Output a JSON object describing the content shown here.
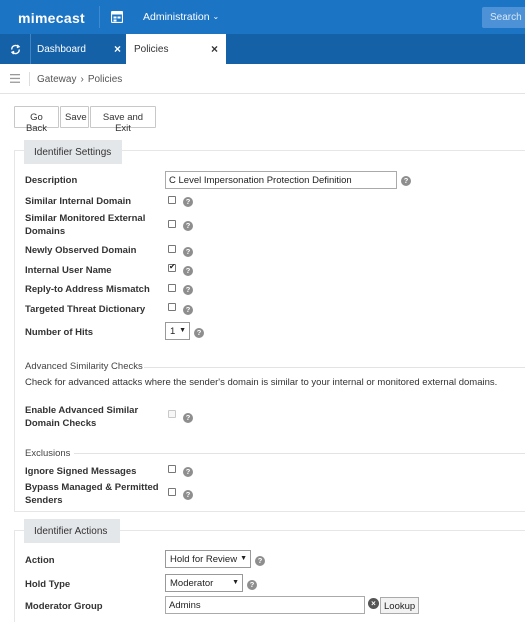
{
  "header": {
    "logo": "mimecast",
    "admin_menu": "Administration",
    "search_placeholder": "Search Mimecast",
    "colors": {
      "header": "#1c74c4",
      "tabbar": "#1461a8"
    }
  },
  "tabs": [
    {
      "label": "Dashboard",
      "close": "×"
    },
    {
      "label": "Policies",
      "close": "×"
    }
  ],
  "breadcrumb": {
    "root": "Gateway",
    "separator": "›",
    "current": "Policies"
  },
  "toolbar": {
    "go_back": "Go Back",
    "save": "Save",
    "save_exit": "Save and Exit"
  },
  "identifier_settings": {
    "title": "Identifier Settings",
    "description_label": "Description",
    "description_value": "C Level Impersonation Protection Definition",
    "rows": [
      {
        "label": "Similar Internal Domain",
        "checked": false
      },
      {
        "label": "Similar Monitored External Domains",
        "checked": false
      },
      {
        "label": "Newly Observed Domain",
        "checked": false
      },
      {
        "label": "Internal User Name",
        "checked": true
      },
      {
        "label": "Reply-to Address Mismatch",
        "checked": false
      },
      {
        "label": "Targeted Threat Dictionary",
        "checked": false
      }
    ],
    "hits_label": "Number of Hits",
    "hits_value": "1",
    "advanced_title": "Advanced Similarity Checks",
    "advanced_desc": "Check for advanced attacks where the sender's domain is similar to your internal or monitored external domains.",
    "advanced_label": "Enable Advanced Similar Domain Checks",
    "exclusions_title": "Exclusions",
    "ignore_signed_label": "Ignore Signed Messages",
    "bypass_label": "Bypass Managed & Permitted Senders"
  },
  "identifier_actions": {
    "title": "Identifier Actions",
    "action_label": "Action",
    "action_value": "Hold for Review",
    "hold_type_label": "Hold Type",
    "hold_type_value": "Moderator",
    "moderator_group_label": "Moderator Group",
    "moderator_group_value": "Admins",
    "lookup_label": "Lookup"
  },
  "icons": {
    "help": "?",
    "clear": "×",
    "caret": "▼"
  }
}
